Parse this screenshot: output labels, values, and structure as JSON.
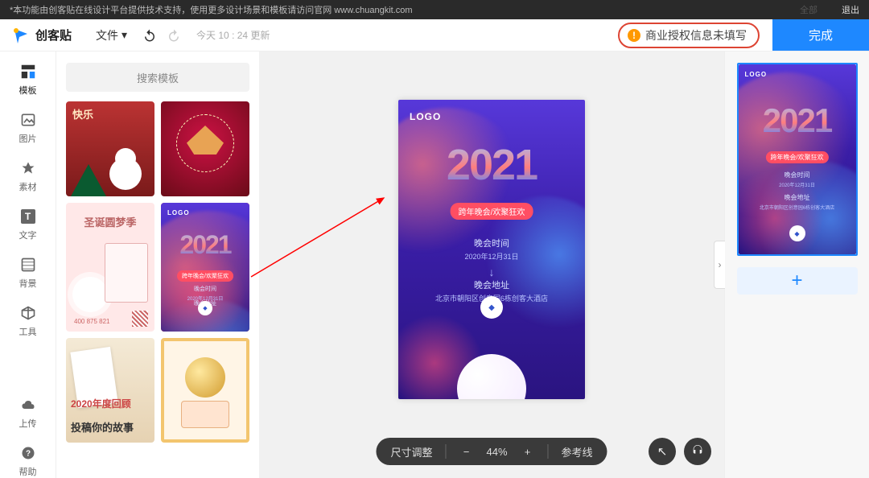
{
  "banner": {
    "text": "*本功能由创客贴在线设计平台提供技术支持，使用更多设计场景和模板请访问官网 www.chuangkit.com",
    "mid": "全部",
    "logout": "退出"
  },
  "header": {
    "brand": "创客贴",
    "file_label": "文件",
    "timestamp": "今天 10 : 24 更新",
    "auth_warning": "商业授权信息未填写",
    "done_label": "完成"
  },
  "sidebar": {
    "items": [
      {
        "label": "模板",
        "icon": "template"
      },
      {
        "label": "图片",
        "icon": "image"
      },
      {
        "label": "素材",
        "icon": "asset"
      },
      {
        "label": "文字",
        "icon": "text"
      },
      {
        "label": "背景",
        "icon": "background"
      },
      {
        "label": "工具",
        "icon": "tools"
      }
    ],
    "bottom": [
      {
        "label": "上传",
        "icon": "upload"
      },
      {
        "label": "帮助",
        "icon": "help"
      }
    ]
  },
  "template_panel": {
    "search_placeholder": "搜索模板",
    "selected_index": 3,
    "cards": [
      {
        "title": "快乐"
      },
      {
        "title": ""
      },
      {
        "title": "圣诞圆梦季",
        "phone": "400 875 821"
      },
      {
        "title": "2021"
      },
      {
        "title": "2020年度回顾",
        "sub": "投稿你的故事"
      },
      {
        "title": ""
      }
    ]
  },
  "poster": {
    "logo": "LOGO",
    "year": "2021",
    "ribbon": "跨年晚会/欢聚狂欢",
    "time_title": "晚会时间",
    "time_body": "2020年12月31日",
    "addr_title": "晚会地址",
    "addr_body": "北京市朝阳区创意园6栋创客大酒店"
  },
  "zoom": {
    "size_label": "尺寸调整",
    "percent": "44%",
    "guides_label": "参考线"
  },
  "page_rail": {
    "add_label": "+"
  }
}
